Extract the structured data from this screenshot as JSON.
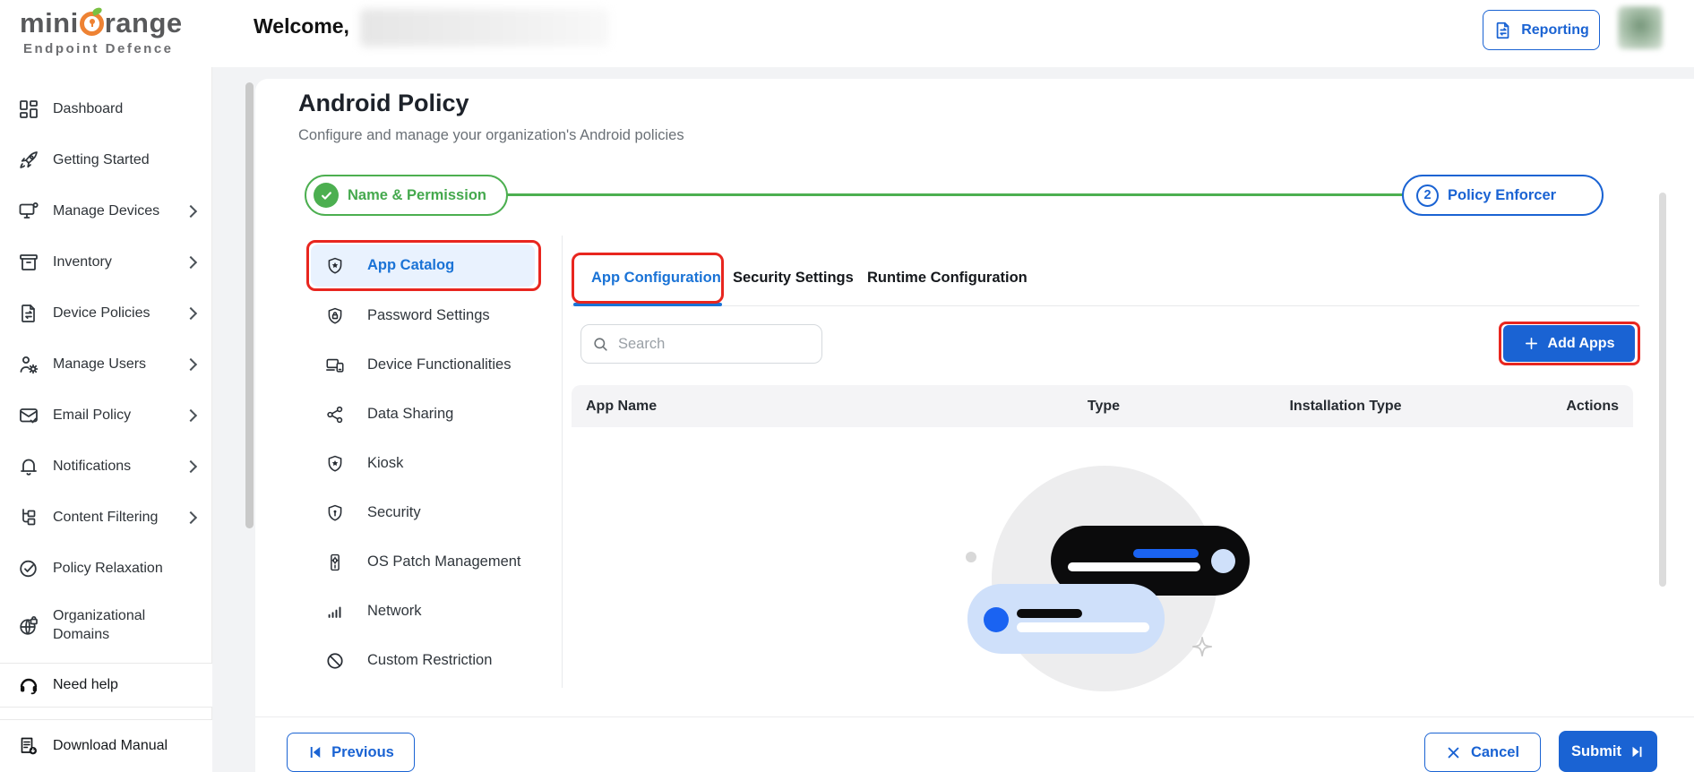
{
  "header": {
    "logo": {
      "part1": "mini",
      "part2": "range",
      "subtitle": "Endpoint Defence"
    },
    "welcome_label": "Welcome,",
    "reporting_label": "Reporting"
  },
  "sidebar": {
    "items": [
      {
        "label": "Dashboard",
        "icon": "dashboard-grid-icon",
        "expandable": false
      },
      {
        "label": "Getting Started",
        "icon": "rocket-icon",
        "expandable": false
      },
      {
        "label": "Manage Devices",
        "icon": "monitor-icon",
        "expandable": true
      },
      {
        "label": "Inventory",
        "icon": "archive-box-icon",
        "expandable": true
      },
      {
        "label": "Device Policies",
        "icon": "document-transfer-icon",
        "expandable": true
      },
      {
        "label": "Manage Users",
        "icon": "user-gear-icon",
        "expandable": true
      },
      {
        "label": "Email Policy",
        "icon": "envelope-check-icon",
        "expandable": true
      },
      {
        "label": "Notifications",
        "icon": "bell-icon",
        "expandable": true
      },
      {
        "label": "Content Filtering",
        "icon": "hierarchy-icon",
        "expandable": true
      },
      {
        "label": "Policy Relaxation",
        "icon": "check-circle-icon",
        "expandable": false
      },
      {
        "label": "Organizational Domains",
        "icon": "globe-lock-icon",
        "expandable": false
      }
    ],
    "need_help_label": "Need help",
    "download_manual_label": "Download Manual"
  },
  "page": {
    "title": "Android Policy",
    "subtitle": "Configure and manage your organization's Android policies"
  },
  "stepper": {
    "steps": [
      {
        "label": "Name & Permission",
        "status": "completed"
      },
      {
        "label": "Policy Enforcer",
        "number": "2",
        "status": "upcoming"
      }
    ]
  },
  "policy_menu": {
    "selected": "App Catalog",
    "items": [
      {
        "label": "App Catalog",
        "icon": "shield-star-icon"
      },
      {
        "label": "Password Settings",
        "icon": "shield-lock-icon"
      },
      {
        "label": "Device Functionalities",
        "icon": "devices-icon"
      },
      {
        "label": "Data Sharing",
        "icon": "share-nodes-icon"
      },
      {
        "label": "Kiosk",
        "icon": "shield-star-icon"
      },
      {
        "label": "Security",
        "icon": "shield-keyhole-icon"
      },
      {
        "label": "OS Patch Management",
        "icon": "phone-gear-icon"
      },
      {
        "label": "Network",
        "icon": "signal-bars-icon"
      },
      {
        "label": "Custom Restriction",
        "icon": "ban-icon"
      }
    ]
  },
  "tabs": [
    {
      "label": "App Configuration",
      "active": true
    },
    {
      "label": "Security Settings",
      "active": false
    },
    {
      "label": "Runtime Configuration",
      "active": false
    }
  ],
  "toolbar": {
    "search_placeholder": "Search",
    "add_apps_label": "Add Apps"
  },
  "table": {
    "columns": [
      "App Name",
      "Type",
      "Installation Type",
      "Actions"
    ],
    "rows": []
  },
  "footer": {
    "previous_label": "Previous",
    "cancel_label": "Cancel",
    "submit_label": "Submit"
  },
  "colors": {
    "primary_blue": "#1a63d3",
    "active_blue": "#1a73d6",
    "green": "#4caf50",
    "annotation_red": "#e8261f",
    "selected_item_bg": "#e9f2fe"
  }
}
